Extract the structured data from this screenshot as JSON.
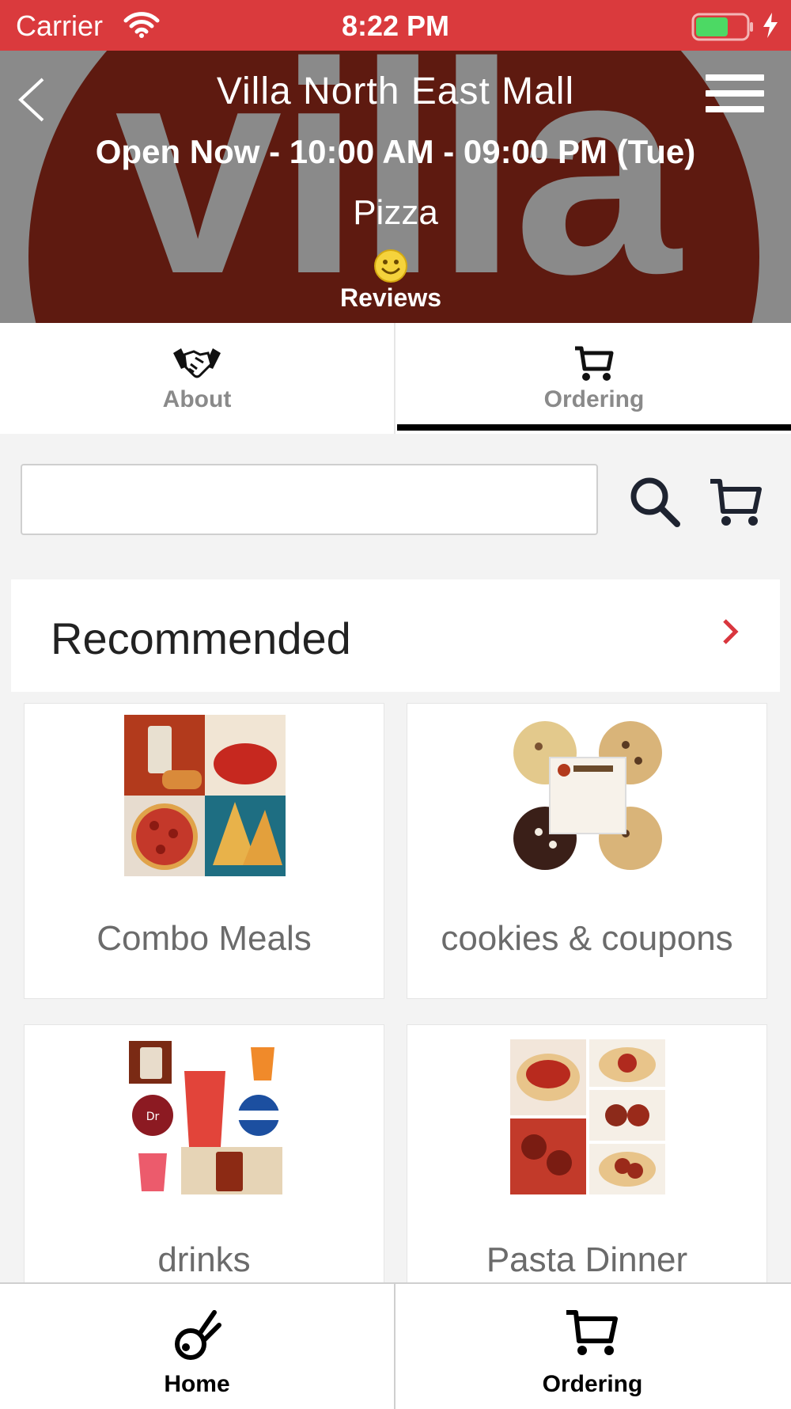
{
  "status_bar": {
    "carrier": "Carrier",
    "time": "8:22 PM",
    "battery_color": "#4cd964"
  },
  "header": {
    "store_name": "Villa North East Mall",
    "hours": "Open Now - 10:00 AM - 09:00 PM (Tue)",
    "cuisine": "Pizza",
    "reviews_label": "Reviews",
    "logo_text": "villa",
    "brand_color": "#5e1a10"
  },
  "tabs": [
    {
      "label": "About",
      "icon": "handshake-icon"
    },
    {
      "label": "Ordering",
      "icon": "cart-icon",
      "active": true
    }
  ],
  "search": {
    "value": "",
    "placeholder": ""
  },
  "recommended": {
    "title": "Recommended"
  },
  "products": [
    {
      "label": "Combo Meals",
      "image": "combo-meals-image"
    },
    {
      "label": "cookies & coupons",
      "image": "cookies-image"
    },
    {
      "label": "drinks",
      "image": "drinks-image"
    },
    {
      "label": "Pasta Dinner",
      "image": "pasta-dinner-image"
    }
  ],
  "bottom_nav": [
    {
      "label": "Home",
      "icon": "home-icon"
    },
    {
      "label": "Ordering",
      "icon": "cart-icon"
    }
  ],
  "colors": {
    "status_bar": "#da3a3d",
    "accent": "#d9363e",
    "active_tab_underline": "#000000"
  }
}
